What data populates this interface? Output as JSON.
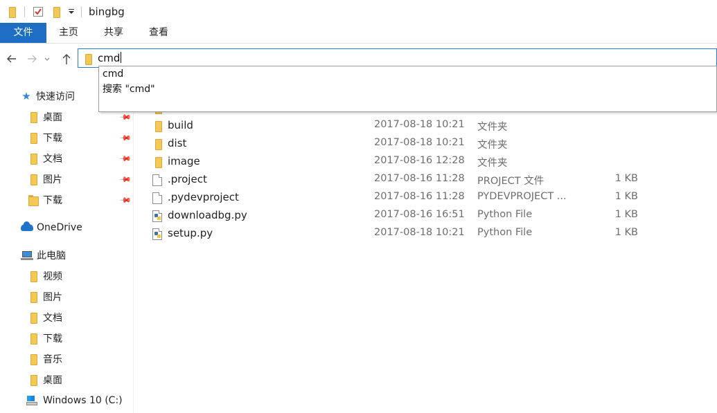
{
  "window": {
    "title": "bingbg",
    "quick_access_icons": [
      "folder-icon",
      "properties-icon",
      "new-folder-icon",
      "customize-dropdown-icon"
    ]
  },
  "ribbon": {
    "tabs": [
      {
        "label": "文件",
        "active": true
      },
      {
        "label": "主页"
      },
      {
        "label": "共享"
      },
      {
        "label": "查看"
      }
    ],
    "file_tab_color": "#1e6fc4"
  },
  "navigation": {
    "back_icon": "back-arrow-icon",
    "forward_icon": "forward-arrow-icon",
    "recent_icon": "chevron-down-icon",
    "up_icon": "up-arrow-icon",
    "address_value": "cmd"
  },
  "autocomplete": {
    "items": [
      "cmd",
      "搜索 \"cmd\""
    ]
  },
  "sidebar": {
    "items": [
      {
        "label": "快速访问",
        "icon": "star-icon"
      },
      {
        "label": "桌面",
        "icon": "desktop-folder-icon",
        "pinned": true
      },
      {
        "label": "下载",
        "icon": "downloads-folder-icon",
        "pinned": true
      },
      {
        "label": "文档",
        "icon": "documents-folder-icon",
        "pinned": true
      },
      {
        "label": "图片",
        "icon": "pictures-folder-icon",
        "pinned": true
      },
      {
        "label": "下载",
        "icon": "folder-icon",
        "pinned": true
      },
      {
        "label": "OneDrive",
        "icon": "onedrive-cloud-icon"
      },
      {
        "label": "此电脑",
        "icon": "this-pc-icon"
      },
      {
        "label": "视频",
        "icon": "videos-folder-icon"
      },
      {
        "label": "图片",
        "icon": "pictures-folder-icon"
      },
      {
        "label": "文档",
        "icon": "documents-folder-icon"
      },
      {
        "label": "下载",
        "icon": "downloads-folder-icon"
      },
      {
        "label": "音乐",
        "icon": "music-folder-icon"
      },
      {
        "label": "桌面",
        "icon": "desktop-folder-icon"
      },
      {
        "label": "Windows 10 (C:)",
        "icon": "windows-drive-icon"
      }
    ]
  },
  "files": [
    {
      "name": "build",
      "date": "2017-08-18 10:21",
      "type": "文件夹",
      "size": "",
      "icon": "folder-icon"
    },
    {
      "name": "dist",
      "date": "2017-08-18 10:21",
      "type": "文件夹",
      "size": "",
      "icon": "folder-icon"
    },
    {
      "name": "image",
      "date": "2017-08-16 12:28",
      "type": "文件夹",
      "size": "",
      "icon": "folder-icon"
    },
    {
      "name": ".project",
      "date": "2017-08-16 11:28",
      "type": "PROJECT 文件",
      "size": "1 KB",
      "icon": "file-icon"
    },
    {
      "name": ".pydevproject",
      "date": "2017-08-16 11:28",
      "type": "PYDEVPROJECT ...",
      "size": "1 KB",
      "icon": "file-icon"
    },
    {
      "name": "downloadbg.py",
      "date": "2017-08-16 16:51",
      "type": "Python File",
      "size": "1 KB",
      "icon": "python-file-icon"
    },
    {
      "name": "setup.py",
      "date": "2017-08-18 10:21",
      "type": "Python File",
      "size": "1 KB",
      "icon": "python-file-icon"
    }
  ]
}
